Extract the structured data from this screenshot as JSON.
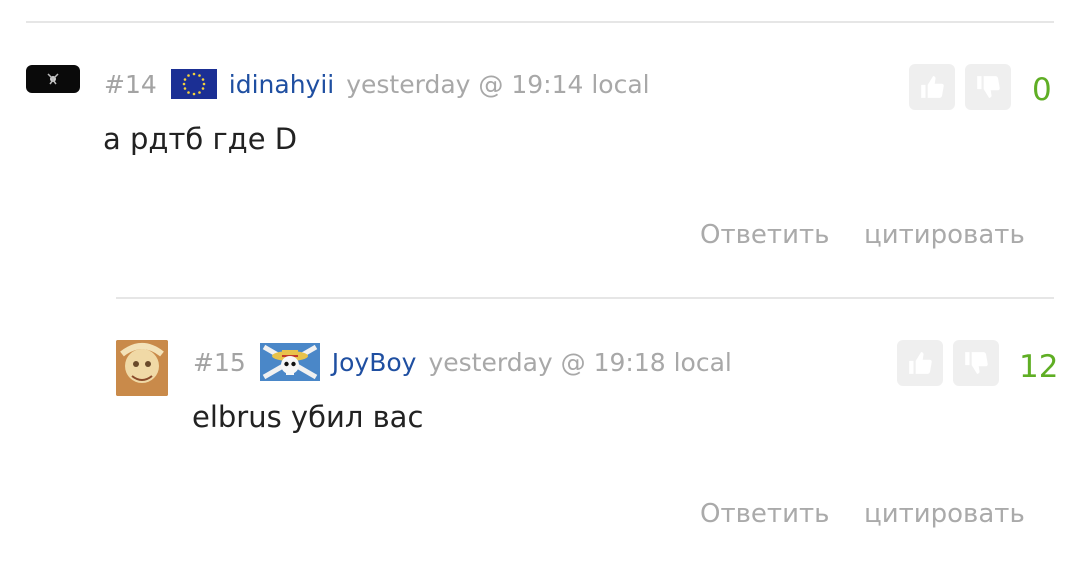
{
  "colors": {
    "username": "#1f4fa1",
    "score_positive": "#5fae24",
    "muted_text": "#a8a8a8",
    "vote_button_bg": "#efefef"
  },
  "comments": [
    {
      "number": "#14",
      "flag_icon": "eu-flag-icon",
      "username": "idinahyii",
      "timestamp": "yesterday @ 19:14 local",
      "text": "а рдтб где D",
      "score": "0",
      "reply_label": "Ответить",
      "quote_label": "цитировать"
    },
    {
      "number": "#15",
      "flag_icon": "jolly-roger-flag-icon",
      "username": "JoyBoy",
      "timestamp": "yesterday @ 19:18 local",
      "text": "elbrus убил вас",
      "score": "12",
      "reply_label": "Ответить",
      "quote_label": "цитировать"
    }
  ]
}
